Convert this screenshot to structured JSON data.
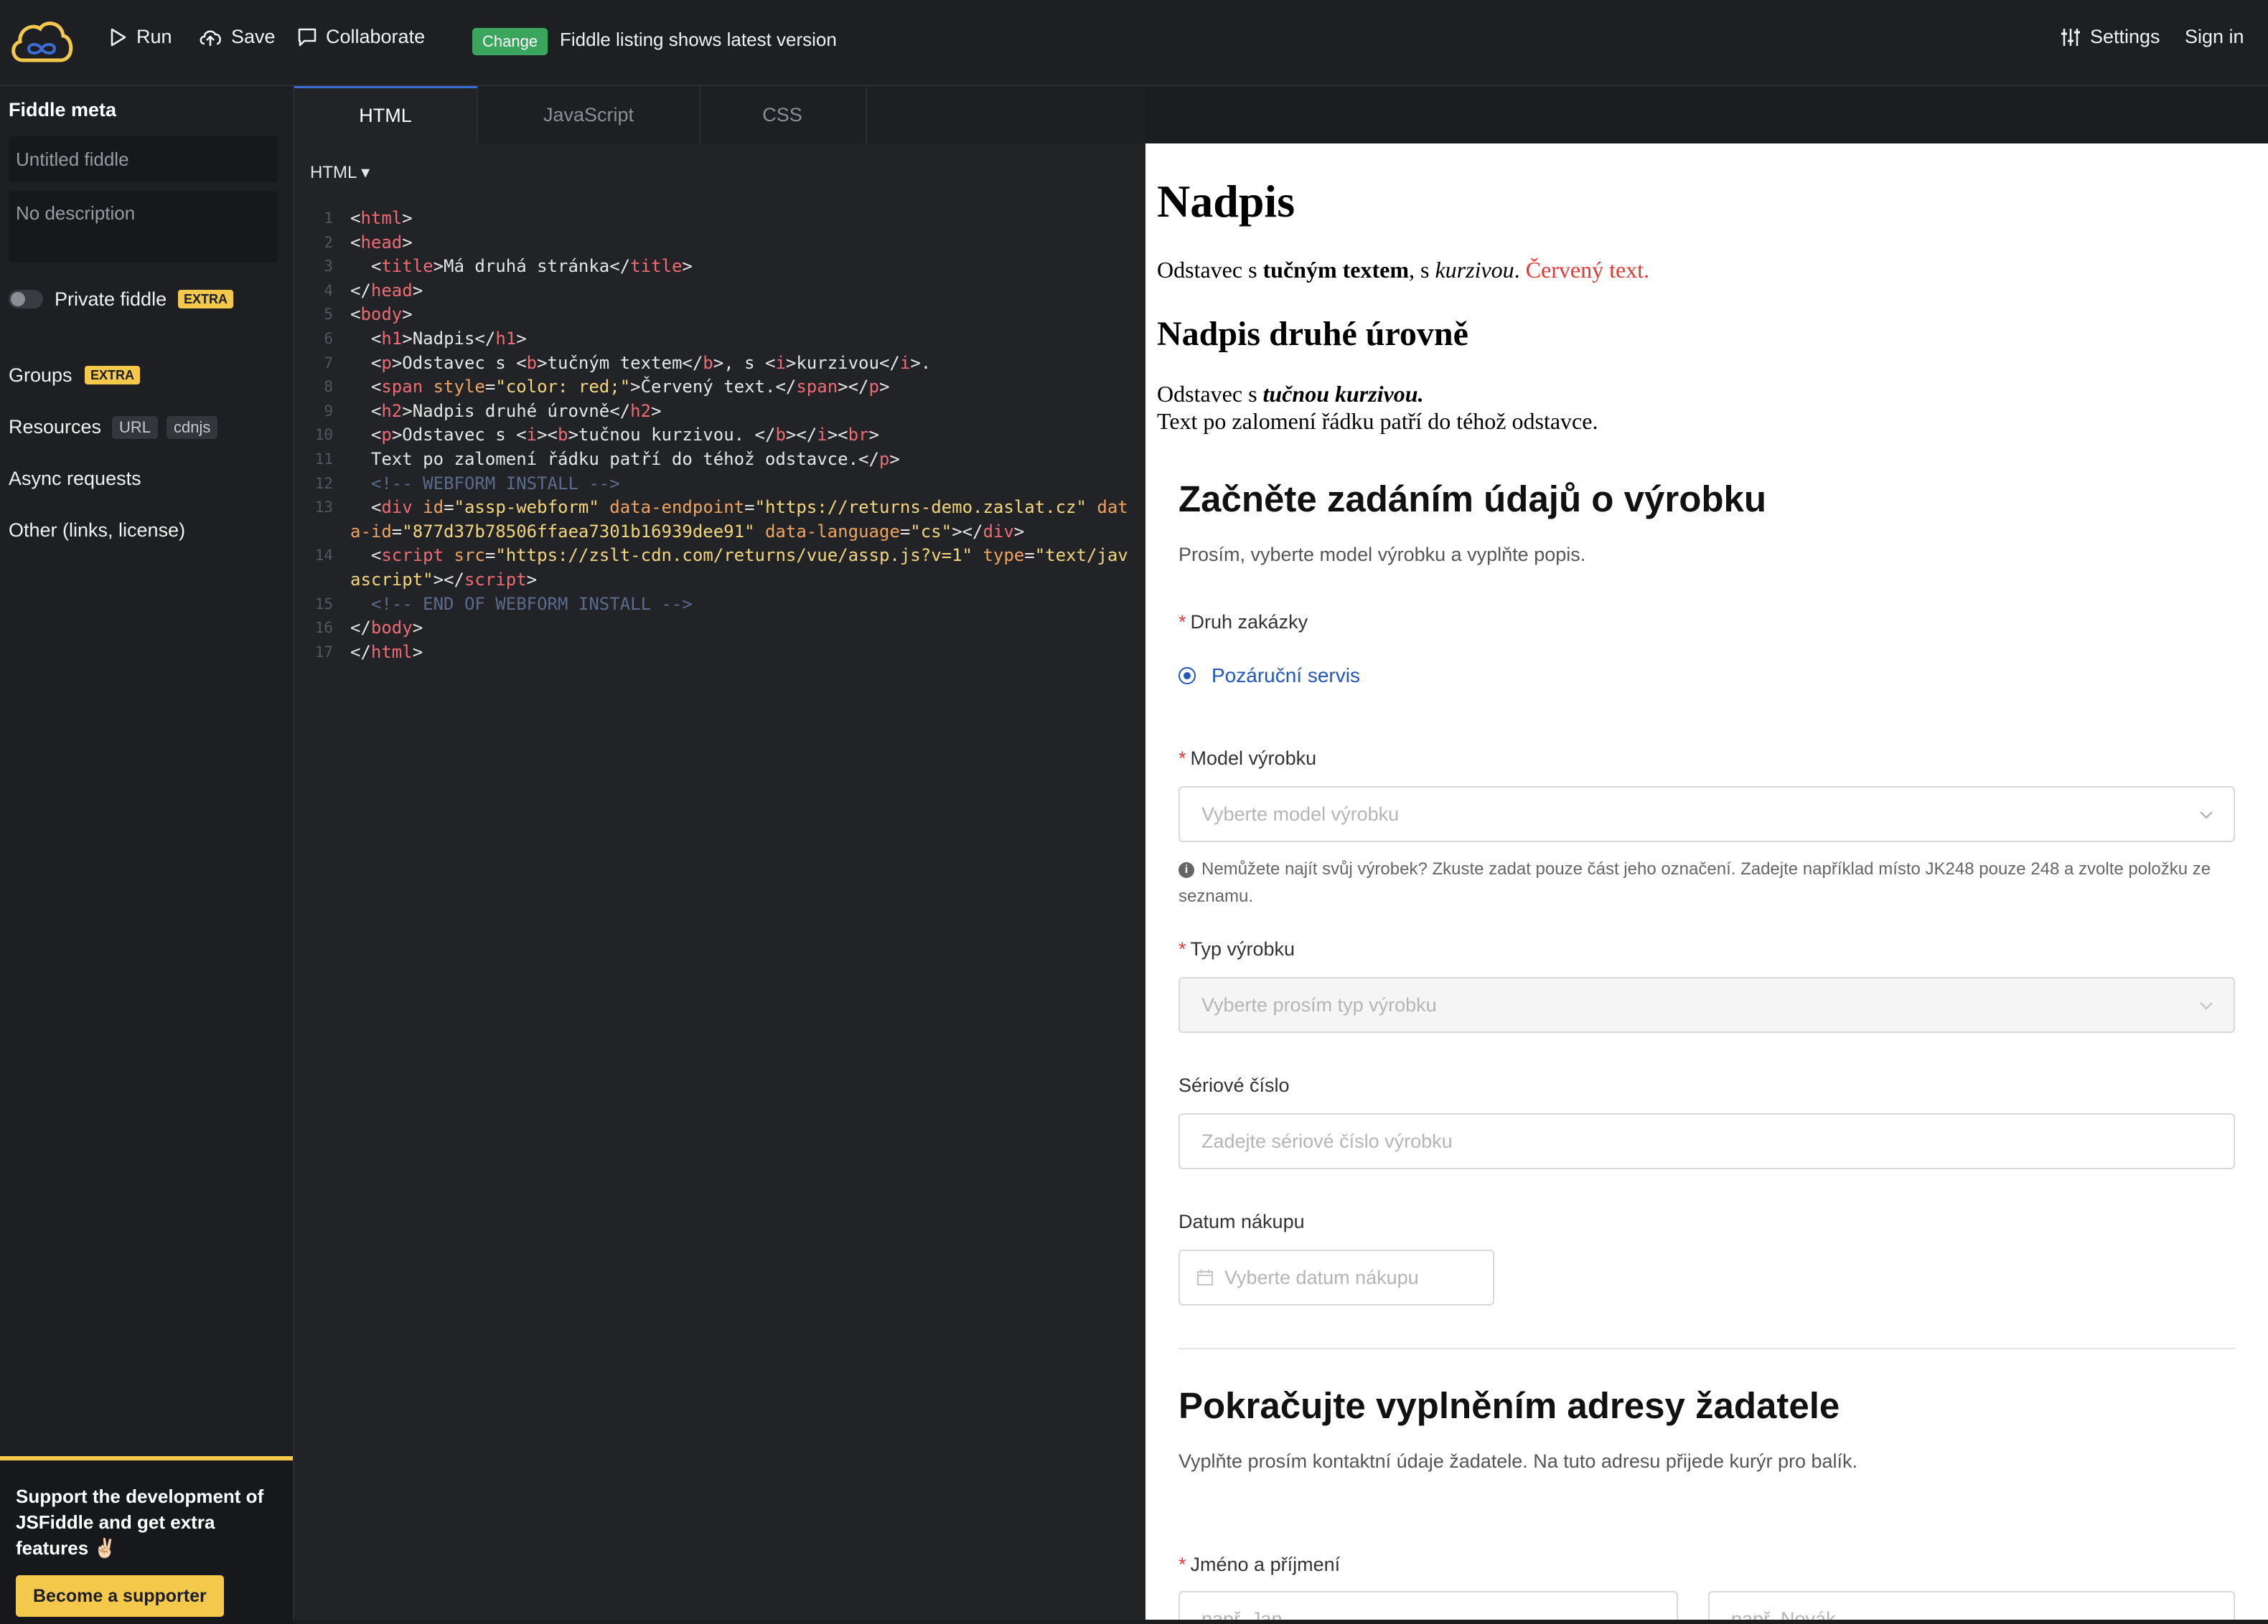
{
  "topbar": {
    "run_label": "Run",
    "save_label": "Save",
    "collaborate_label": "Collaborate",
    "change_badge": "Change",
    "change_text": "Fiddle listing shows latest version",
    "settings_label": "Settings",
    "signin_label": "Sign in",
    "icons": [
      "logo-cloud-icon",
      "play-icon",
      "cloud-upload-icon",
      "chat-icon",
      "sliders-icon"
    ]
  },
  "sidebar": {
    "title": "Fiddle meta",
    "title_placeholder": "Untitled fiddle",
    "description_placeholder": "No description",
    "private_label": "Private fiddle",
    "extra_tag": "EXTRA",
    "groups_label": "Groups",
    "resources_label": "Resources",
    "resources_tags": [
      "URL",
      "cdnjs"
    ],
    "async_label": "Async requests",
    "other_label": "Other (links, license)",
    "support_text": "Support the development of JSFiddle and get extra features ✌🏻",
    "support_button": "Become a supporter"
  },
  "editor": {
    "tabs": [
      "HTML",
      "JavaScript",
      "CSS"
    ],
    "active_tab": "HTML",
    "language": "HTML",
    "line_numbers": [
      "1",
      "2",
      "3",
      "4",
      "5",
      "6",
      "7",
      "8",
      "9",
      "10",
      "11",
      "12",
      "13",
      "14",
      "15",
      "16",
      "17"
    ]
  },
  "result": {
    "h1": "Nadpis",
    "p1_start": "Odstavec s ",
    "p1_bold": "tučným textem",
    "p1_mid": ", s ",
    "p1_italic": "kurzivou",
    "p1_dot": ". ",
    "p1_red": "Červený text.",
    "h2": "Nadpis druhé úrovně",
    "p2_start": "Odstavec s ",
    "p2_bolditalic": "tučnou kurzivou.",
    "p2_line2": "Text po zalomení řádku patří do téhož odstavce.",
    "form": {
      "section1_title": "Začněte zadáním údajů o výrobku",
      "section1_sub": "Prosím, vyberte model výrobku a vyplňte popis.",
      "order_type_label": "Druh zakázky",
      "order_type_option": "Pozáruční servis",
      "model_label": "Model výrobku",
      "model_placeholder": "Vyberte model výrobku",
      "help_text": "Nemůžete najít svůj výrobek? Zkuste zadat pouze část jeho označení. Zadejte například místo JK248 pouze 248 a zvolte položku ze seznamu.",
      "type_label": "Typ výrobku",
      "type_placeholder": "Vyberte prosím typ výrobku",
      "serial_label": "Sériové číslo",
      "serial_placeholder": "Zadejte sériové číslo výrobku",
      "date_label": "Datum nákupu",
      "date_placeholder": "Vyberte datum nákupu",
      "section2_title": "Pokračujte vyplněním adresy žadatele",
      "section2_sub": "Vyplňte prosím kontaktní údaje žadatele. Na tuto adresu přijede kurýr pro balík.",
      "name_label": "Jméno a příjmení",
      "first_placeholder": "např. Jan",
      "last_placeholder": "např. Novák"
    }
  },
  "colors": {
    "accent_yellow": "#f4c84a",
    "change_green": "#3aa55c",
    "active_tab_blue": "#3b6dd6",
    "red_text": "#e53935",
    "radio_blue": "#2457b8"
  }
}
